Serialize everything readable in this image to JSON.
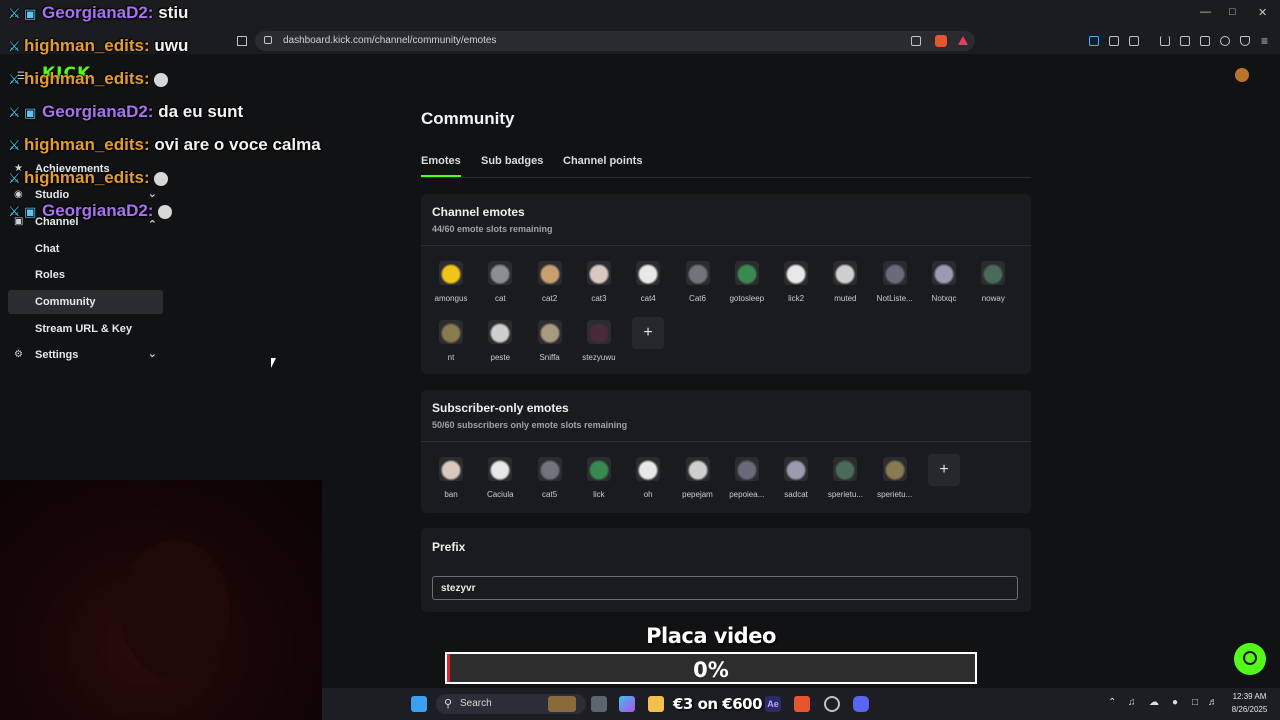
{
  "browser": {
    "url": "dashboard.kick.com/channel/community/emotes"
  },
  "sidebar": {
    "items": [
      {
        "label": "Achievements",
        "icon": "trophy-icon"
      },
      {
        "label": "Studio",
        "icon": "studio-icon",
        "chevron": "chevron-down"
      },
      {
        "label": "Channel",
        "icon": "channel-icon",
        "chevron": "chevron-up"
      },
      {
        "label": "Chat"
      },
      {
        "label": "Roles"
      },
      {
        "label": "Community",
        "active": true
      },
      {
        "label": "Stream URL & Key"
      },
      {
        "label": "Settings",
        "icon": "gear-icon",
        "chevron": "chevron-down"
      }
    ]
  },
  "main": {
    "title": "Community",
    "tabs": [
      "Emotes",
      "Sub badges",
      "Channel points"
    ],
    "active_tab": "Emotes",
    "channel_emotes": {
      "title": "Channel emotes",
      "subtitle": "44/60 emote slots remaining",
      "emotes": [
        "amongus",
        "cat",
        "cat2",
        "cat3",
        "cat4",
        "Cat6",
        "gotosleep",
        "lick2",
        "muted",
        "NotListe...",
        "Notxqc",
        "noway",
        "nt",
        "peste",
        "Sniffa",
        "stezyuwu"
      ]
    },
    "subscriber_emotes": {
      "title": "Subscriber-only emotes",
      "subtitle": "50/60 subscribers only emote slots remaining",
      "emotes": [
        "ban",
        "Caciula",
        "cat5",
        "lick",
        "oh",
        "pepejam",
        "pepoiea...",
        "sadcat",
        "sperietu...",
        "sperietu..."
      ]
    },
    "prefix": {
      "title": "Prefix",
      "value": "stezyvr"
    }
  },
  "chat_overlay": [
    {
      "user": "GeorgianaD2:",
      "message": "stiu",
      "color": "#a872f0"
    },
    {
      "user": "highman_edits:",
      "message": "uwu",
      "color": "#e69b2a"
    },
    {
      "user": "highman_edits:",
      "message": "",
      "color": "#e69b2a"
    },
    {
      "user": "GeorgianaD2:",
      "message": "da eu sunt",
      "color": "#a872f0"
    },
    {
      "user": "highman_edits:",
      "message": "ovi are o voce calma",
      "color": "#e69b2a"
    },
    {
      "user": "highman_edits:",
      "message": "",
      "color": "#e69b2a"
    },
    {
      "user": "GeorgianaD2:",
      "message": "",
      "color": "#a872f0"
    }
  ],
  "overlay_progress": {
    "title": "Placa video",
    "percent_label": "0%",
    "progress": 0.005
  },
  "taskbar": {
    "search_label": "Search",
    "promo_label": "€3 on €600",
    "time": "12:39 AM",
    "date": "8/26/2025"
  },
  "colors": {
    "accent": "#53fc18",
    "background": "#111214",
    "card": "#1a1b1e"
  }
}
